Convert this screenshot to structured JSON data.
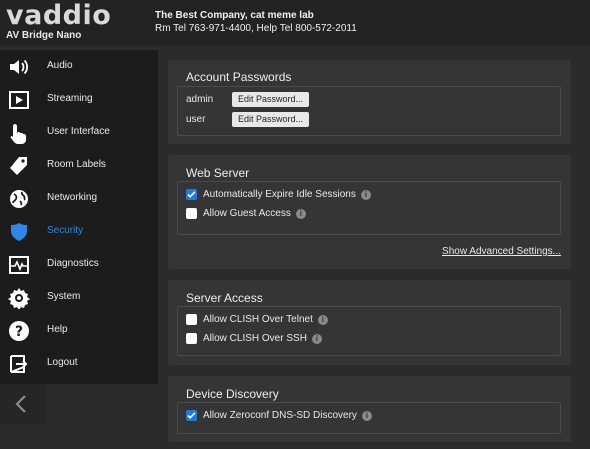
{
  "header": {
    "logo_text": "vaddio",
    "product": "AV Bridge Nano",
    "company": "The Best Company, cat meme lab",
    "contact": "Rm Tel 763-971-4400, Help Tel 800-572-2011"
  },
  "sidebar": {
    "items": [
      {
        "label": "Audio",
        "icon": "speaker-icon"
      },
      {
        "label": "Streaming",
        "icon": "play-icon"
      },
      {
        "label": "User Interface",
        "icon": "hand-pointer-icon"
      },
      {
        "label": "Room Labels",
        "icon": "tag-icon"
      },
      {
        "label": "Networking",
        "icon": "globe-icon"
      },
      {
        "label": "Security",
        "icon": "shield-icon",
        "active": true
      },
      {
        "label": "Diagnostics",
        "icon": "pulse-icon"
      },
      {
        "label": "System",
        "icon": "gear-icon"
      },
      {
        "label": "Help",
        "icon": "help-icon"
      },
      {
        "label": "Logout",
        "icon": "logout-icon"
      }
    ],
    "back_icon": "chevron-left-icon"
  },
  "account_passwords": {
    "title": "Account Passwords",
    "users": [
      {
        "name": "admin",
        "button": "Edit Password..."
      },
      {
        "name": "user",
        "button": "Edit Password..."
      }
    ]
  },
  "web_server": {
    "title": "Web Server",
    "options": [
      {
        "label": "Automatically Expire Idle Sessions",
        "checked": true
      },
      {
        "label": "Allow Guest Access",
        "checked": false
      }
    ],
    "advanced_link": "Show Advanced Settings..."
  },
  "server_access": {
    "title": "Server Access",
    "options": [
      {
        "label": "Allow CLISH Over Telnet",
        "checked": false
      },
      {
        "label": "Allow CLISH Over SSH",
        "checked": false
      }
    ]
  },
  "device_discovery": {
    "title": "Device Discovery",
    "options": [
      {
        "label": "Allow Zeroconf DNS-SD Discovery",
        "checked": true
      }
    ]
  },
  "colors": {
    "accent": "#2f86ea",
    "background": "#2b2b2b",
    "panel": "#353535",
    "sidebar": "#1c1c1c"
  }
}
